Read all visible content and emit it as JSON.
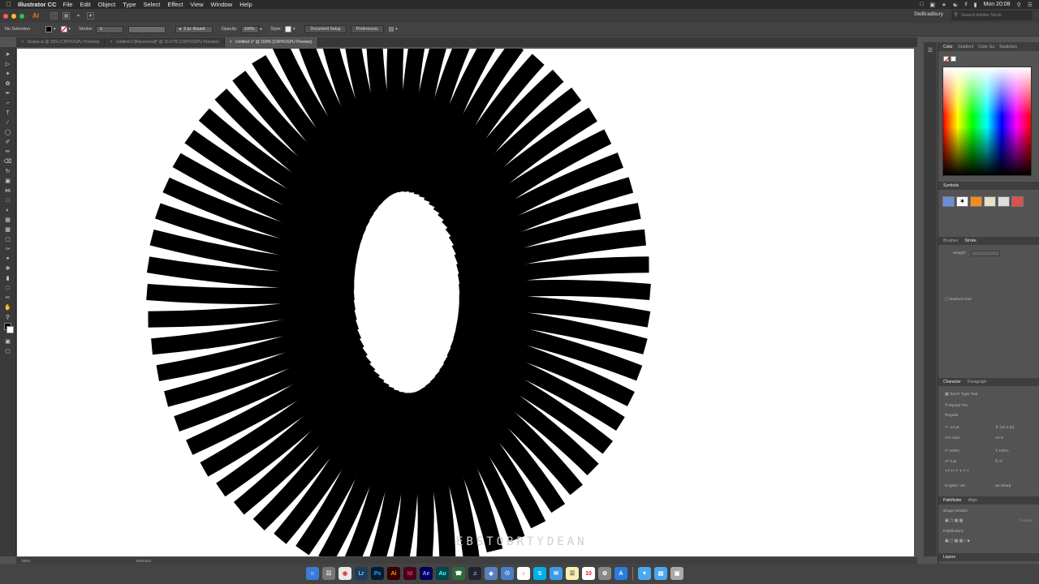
{
  "menubar": {
    "apple": "",
    "app_name": "Illustrator CC",
    "items": [
      "File",
      "Edit",
      "Object",
      "Type",
      "Select",
      "Effect",
      "View",
      "Window",
      "Help"
    ],
    "clock": "Mon 20:08"
  },
  "titlebar": {
    "logo": "Ai",
    "user": "SteBradbury",
    "stock_placeholder": "Search Adobe Stock"
  },
  "control": {
    "selection": "No Selection",
    "stroke_label": "Stroke:",
    "brush": "5 pt. Round",
    "opacity_label": "Opacity:",
    "opacity_value": "100%",
    "style_label": "Style:",
    "document_setup": "Document Setup",
    "preferences": "Preferences"
  },
  "tabs": [
    {
      "label": "Stripes.ai @ 25% (CMYK/GPU Preview)",
      "active": false
    },
    {
      "label": "Untitled-2 [Recovered]* @ 16.67% (CMYK/GPU Preview)",
      "active": false
    },
    {
      "label": "Untitled-1* @ 150% (CMYK/GPU Preview)",
      "active": true
    }
  ],
  "status": {
    "zoom": "150%",
    "tool": "Selection"
  },
  "watermark": "EBSTOBRTYDEAN",
  "panels": {
    "color_tabs": [
      "Color",
      "Gradient",
      "Color Gu",
      "Swatches"
    ],
    "symbols_title": "Symbols",
    "brush_tabs": [
      "Brushes",
      "Stroke"
    ],
    "weight_label": "Weight:",
    "dashed_line": "Dashed Line",
    "char_tabs": [
      "Character",
      "Paragraph"
    ],
    "touch_type": "Touch Type Tool",
    "font_family": "Myriad Pro",
    "font_style": "Regular",
    "font_size": "12 pt",
    "leading": "(14.4 pt)",
    "kerning": "Auto",
    "tracking": "0",
    "scale_v": "100%",
    "scale_h": "100%",
    "baseline": "0 pt",
    "rotation": "0°",
    "language": "English: UK",
    "antialias": "Sharp",
    "pathfinder_tabs": [
      "Pathfinder",
      "Align"
    ],
    "shape_modes": "Shape Modes:",
    "expand": "Expand",
    "pathfinders": "Pathfinders:",
    "layers": "Layers"
  }
}
